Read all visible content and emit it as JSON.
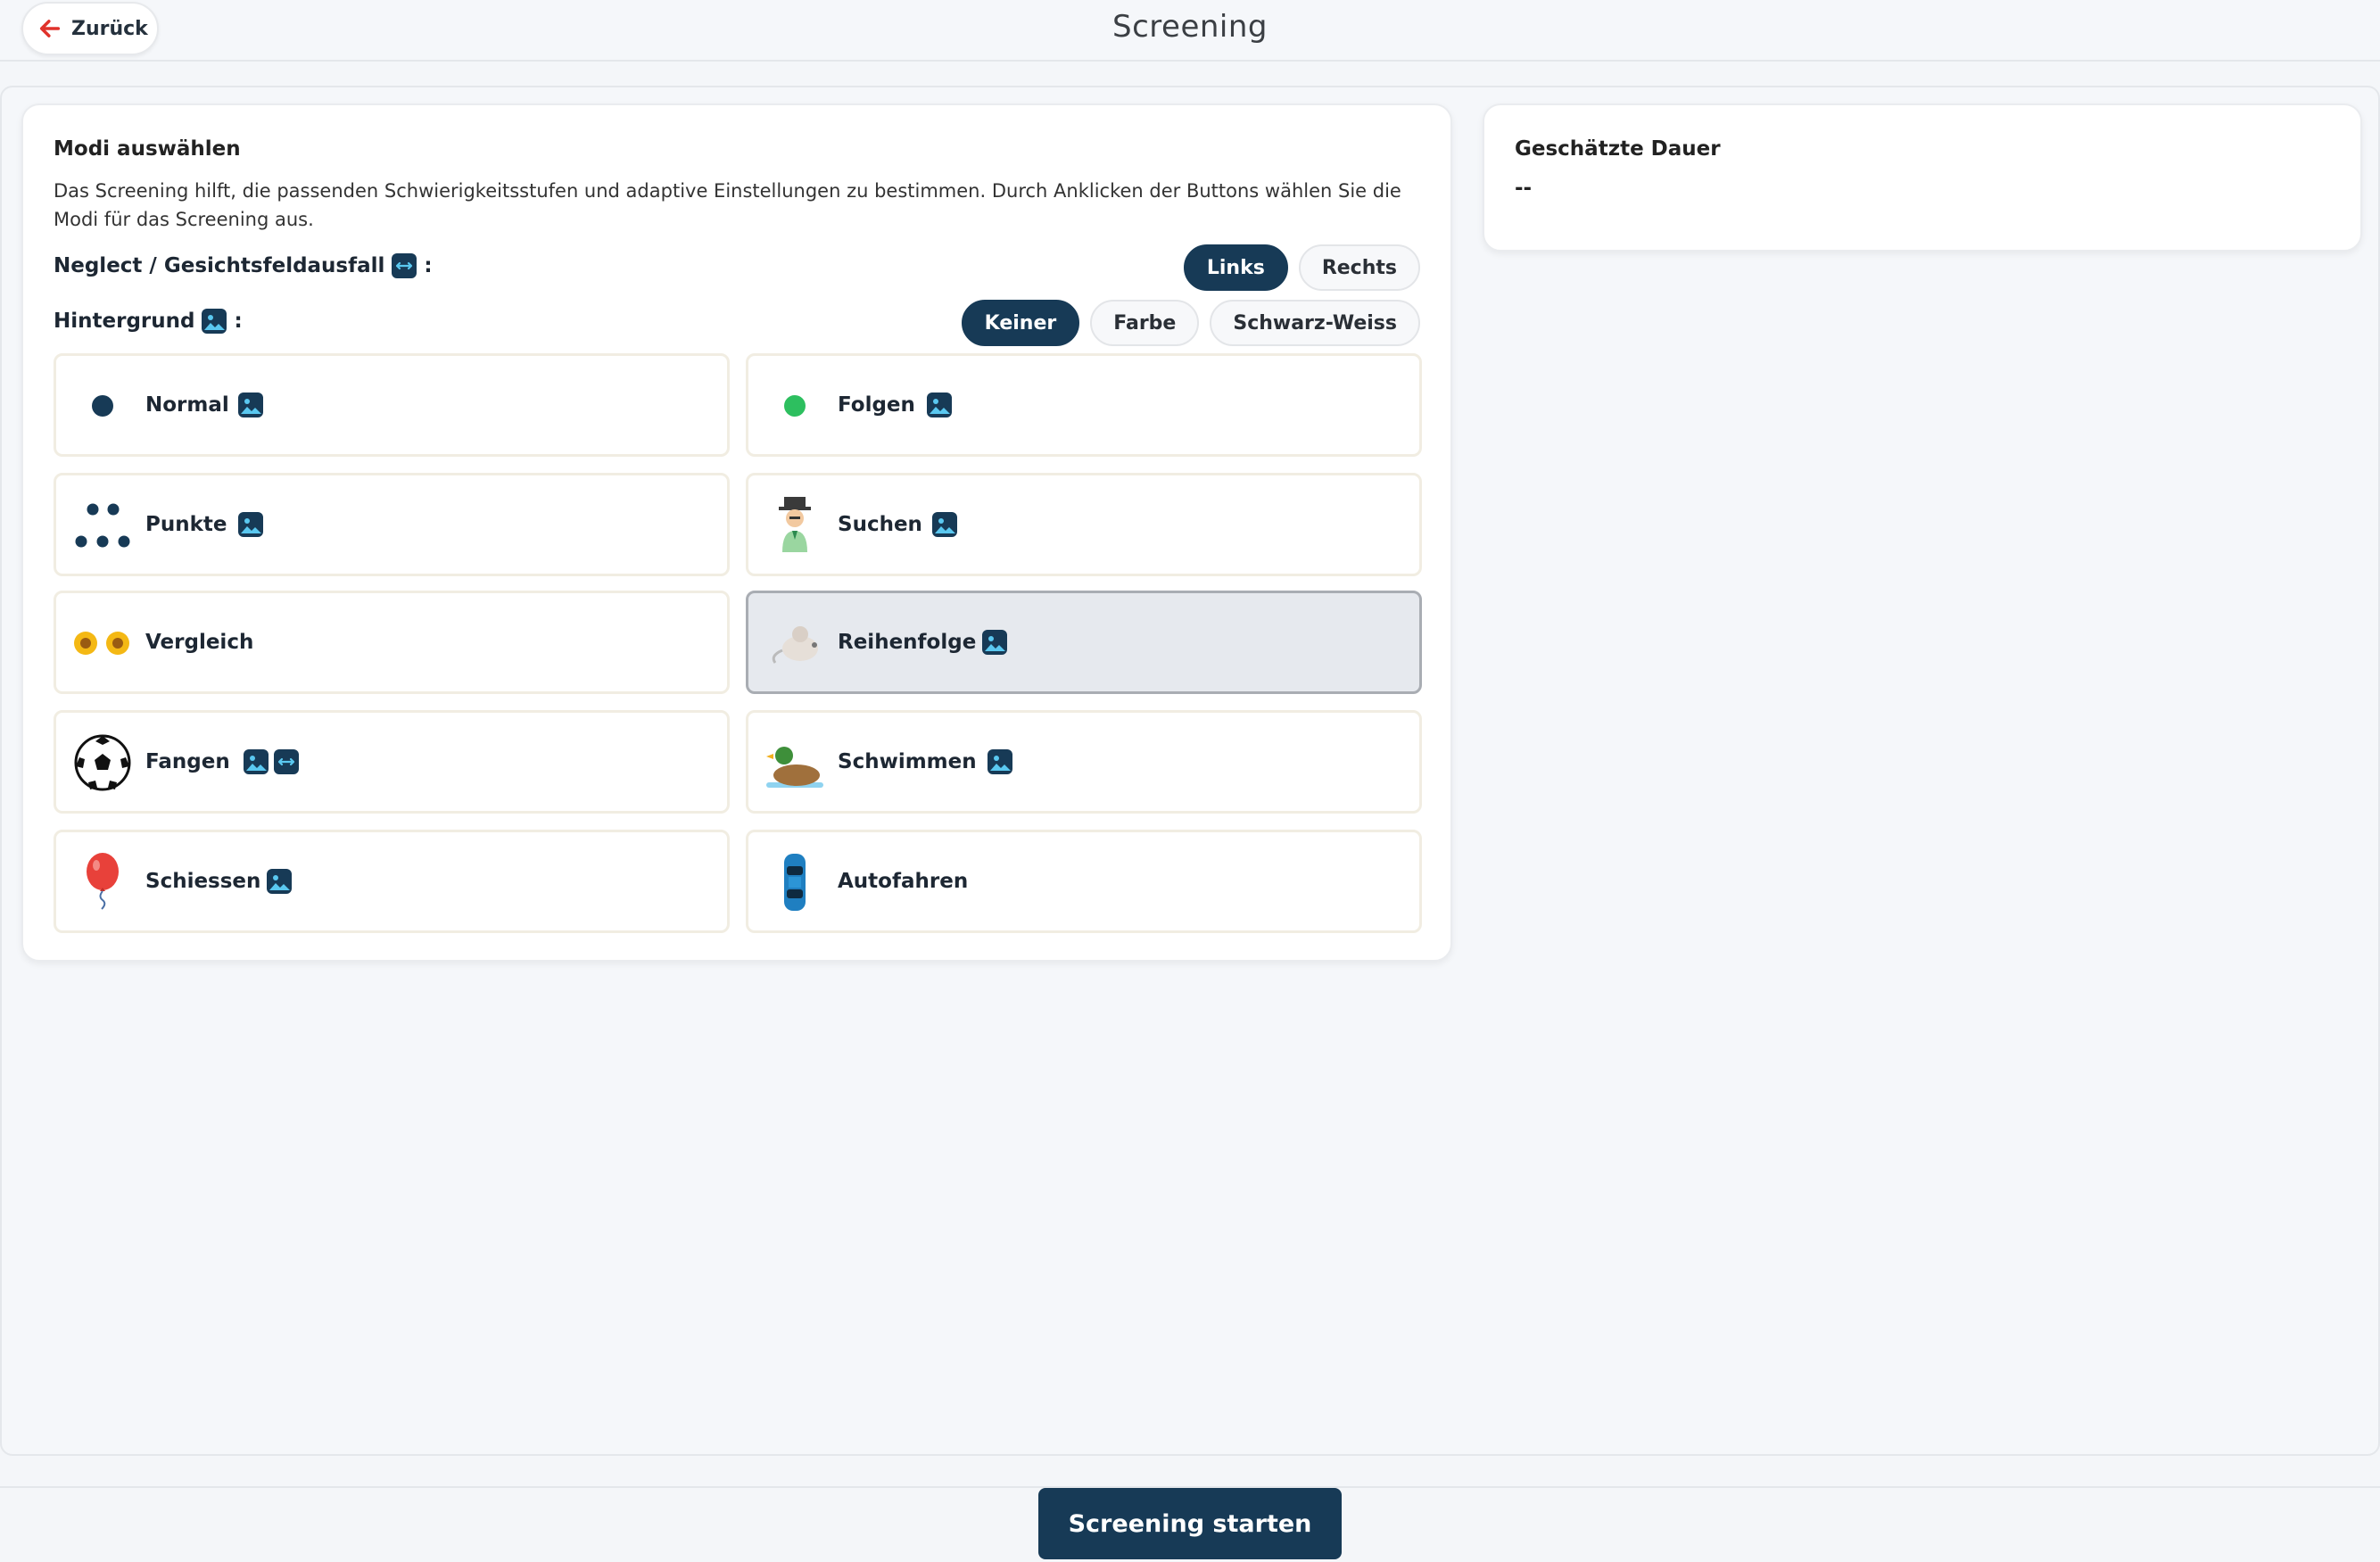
{
  "header": {
    "back_label": "Zurück",
    "title": "Screening"
  },
  "modes_card": {
    "heading": "Modi auswählen",
    "description": "Das Screening hilft, die passenden Schwierigkeitsstufen und adaptive Einstellungen zu bestimmen. Durch Anklicken der Buttons wählen Sie die Modi für das Screening aus.",
    "neglect": {
      "label": "Neglect / Gesichtsfeldausfall",
      "colon": ":",
      "options": [
        "Links",
        "Rechts"
      ],
      "selected": "Links"
    },
    "background": {
      "label": "Hintergrund",
      "colon": ":",
      "options": [
        "Keiner",
        "Farbe",
        "Schwarz-Weiss"
      ],
      "selected": "Keiner"
    },
    "modes": [
      {
        "name": "Normal",
        "icon": "dark-dot-icon",
        "badges": [
          "image-badge-icon"
        ]
      },
      {
        "name": "Folgen",
        "icon": "green-dot-icon",
        "badges": [
          "image-badge-icon"
        ]
      },
      {
        "name": "Punkte",
        "icon": "dots-icon",
        "badges": [
          "image-badge-icon"
        ]
      },
      {
        "name": "Suchen",
        "icon": "detective-icon",
        "badges": [
          "image-badge-icon"
        ]
      },
      {
        "name": "Vergleich",
        "icon": "sunflowers-icon",
        "badges": []
      },
      {
        "name": "Reihenfolge",
        "icon": "mouse-icon",
        "badges": [
          "image-badge-icon"
        ],
        "selected": true
      },
      {
        "name": "Fangen",
        "icon": "soccer-ball-icon",
        "badges": [
          "image-badge-icon",
          "neglect-badge-icon"
        ]
      },
      {
        "name": "Schwimmen",
        "icon": "duck-icon",
        "badges": [
          "image-badge-icon"
        ]
      },
      {
        "name": "Schiessen",
        "icon": "balloon-icon",
        "badges": [
          "image-badge-icon"
        ]
      },
      {
        "name": "Autofahren",
        "icon": "car-icon",
        "badges": []
      }
    ]
  },
  "duration_card": {
    "title": "Geschätzte Dauer",
    "value": "--"
  },
  "footer": {
    "start_label": "Screening starten"
  },
  "colors": {
    "primary": "#173a56",
    "accent_red": "#e0322b",
    "green": "#2dbf5f",
    "badge_sky": "#5ac8f0"
  }
}
